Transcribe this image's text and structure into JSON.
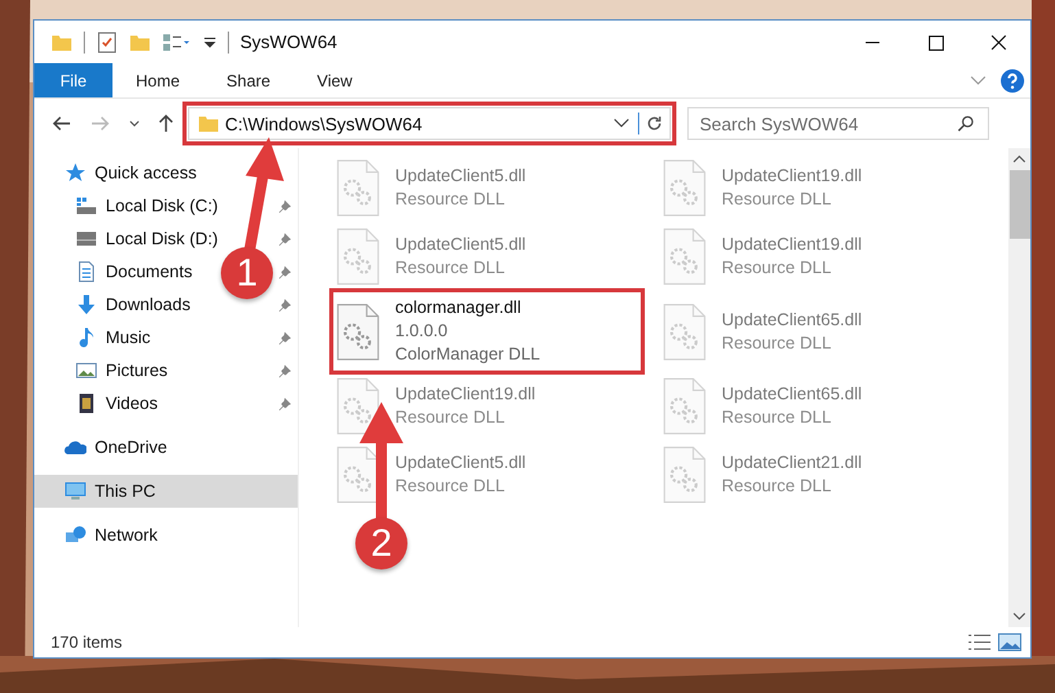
{
  "window": {
    "title": "SysWOW64"
  },
  "ribbon": [
    {
      "label": "File",
      "kind": "file"
    },
    {
      "label": "Home",
      "kind": "tab"
    },
    {
      "label": "Share",
      "kind": "tab"
    },
    {
      "label": "View",
      "kind": "tab"
    }
  ],
  "address": {
    "path": "C:\\Windows\\SysWOW64",
    "highlighted": true
  },
  "search": {
    "placeholder": "Search SysWOW64"
  },
  "nav": [
    {
      "label": "Quick access",
      "kind": "star",
      "selected": false,
      "children": [
        {
          "label": "Local Disk (C:)",
          "kind": "systemdrive",
          "pinned": true,
          "selected": false
        },
        {
          "label": "Local Disk (D:)",
          "kind": "drive",
          "pinned": true,
          "selected": false
        },
        {
          "label": "Documents",
          "kind": "document",
          "pinned": true,
          "selected": false
        },
        {
          "label": "Downloads",
          "kind": "download",
          "pinned": true,
          "selected": false
        },
        {
          "label": "Music",
          "kind": "music",
          "pinned": true,
          "selected": false
        },
        {
          "label": "Pictures",
          "kind": "pictures",
          "pinned": true,
          "selected": false
        },
        {
          "label": "Videos",
          "kind": "videos",
          "pinned": true,
          "selected": false
        }
      ]
    },
    {
      "label": "OneDrive",
      "kind": "cloud",
      "selected": false
    },
    {
      "label": "This PC",
      "kind": "computer",
      "selected": true
    },
    {
      "label": "Network",
      "kind": "network",
      "selected": false
    }
  ],
  "files": [
    {
      "name": "UpdateClient5.dll",
      "type": "Resource DLL",
      "blurred": true,
      "highlighted": false
    },
    {
      "name": "UpdateClient19.dll",
      "type": "Resource DLL",
      "blurred": true,
      "highlighted": false
    },
    {
      "name": "UpdateClient5.dll",
      "type": "Resource DLL",
      "blurred": true,
      "highlighted": false
    },
    {
      "name": "UpdateClient19.dll",
      "type": "Resource DLL",
      "blurred": true,
      "highlighted": false
    },
    {
      "name": "colormanager.dll",
      "version": "1.0.0.0",
      "type": "ColorManager DLL",
      "blurred": false,
      "highlighted": true
    },
    {
      "name": "UpdateClient65.dll",
      "type": "Resource DLL",
      "blurred": true,
      "highlighted": false
    },
    {
      "name": "UpdateClient19.dll",
      "type": "Resource DLL",
      "blurred": true,
      "highlighted": false
    },
    {
      "name": "UpdateClient65.dll",
      "type": "Resource DLL",
      "blurred": true,
      "highlighted": false
    },
    {
      "name": "UpdateClient5.dll",
      "type": "Resource DLL",
      "blurred": true,
      "highlighted": false
    },
    {
      "name": "UpdateClient21.dll",
      "type": "Resource DLL",
      "blurred": true,
      "highlighted": false
    }
  ],
  "status_bar": {
    "count": "170 items"
  },
  "callouts": [
    {
      "label": "1"
    },
    {
      "label": "2"
    }
  ]
}
